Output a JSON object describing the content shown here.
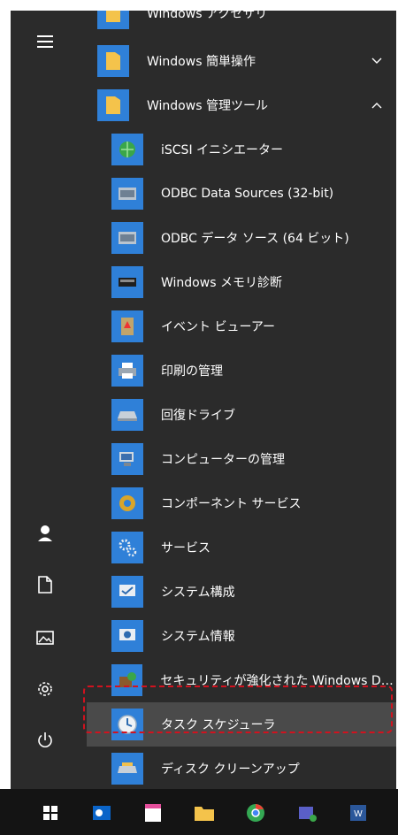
{
  "start_menu": {
    "groups": [
      {
        "label": "Windows アクセサリ"
      },
      {
        "label": "Windows 簡単操作"
      },
      {
        "label": "Windows 管理ツール"
      }
    ],
    "admin_tools": [
      {
        "label": "iSCSI イニシエーター"
      },
      {
        "label": "ODBC Data Sources (32-bit)"
      },
      {
        "label": "ODBC データ ソース (64 ビット)"
      },
      {
        "label": "Windows メモリ診断"
      },
      {
        "label": "イベント ビューアー"
      },
      {
        "label": "印刷の管理"
      },
      {
        "label": "回復ドライブ"
      },
      {
        "label": "コンピューターの管理"
      },
      {
        "label": "コンポーネント サービス"
      },
      {
        "label": "サービス"
      },
      {
        "label": "システム構成"
      },
      {
        "label": "システム情報"
      },
      {
        "label": "セキュリティが強化された Windows De..."
      },
      {
        "label": "タスク スケジューラ"
      },
      {
        "label": "ディスク クリーンアップ"
      }
    ],
    "selected_item": "タスク スケジューラ"
  },
  "colors": {
    "menu_bg": "#2b2b2b",
    "tile_blue": "#2f80d8",
    "highlight_dash": "#d1121f",
    "taskbar_bg": "#141414"
  }
}
